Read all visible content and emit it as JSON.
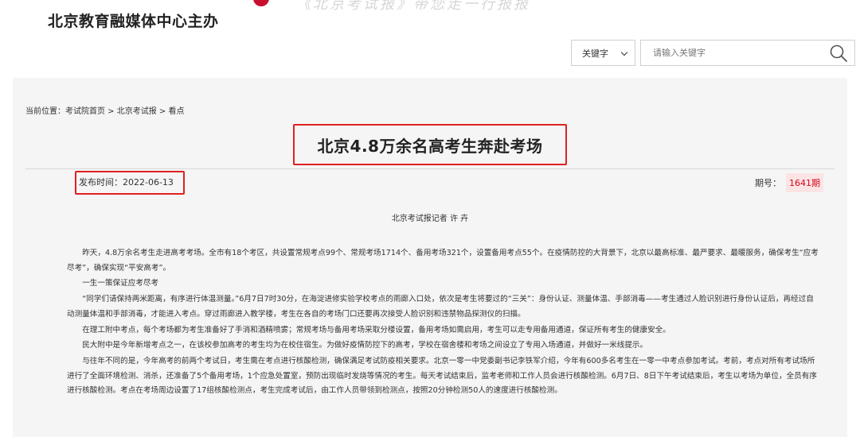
{
  "header": {
    "slogan": "《北京考试报》带您走一行报报",
    "org_title": "北京教育融媒体中心主办",
    "search": {
      "select_value": "关键字",
      "placeholder": "请输入关键字",
      "button_icon": "search-icon"
    }
  },
  "article": {
    "breadcrumb": {
      "prefix": "当前位置：",
      "items": [
        "考试院首页",
        "北京考试报",
        "看点"
      ],
      "separator": " > "
    },
    "title": "北京4.8万余名高考生奔赴考场",
    "publish_label": "发布时间：",
    "publish_date": "2022-06-13",
    "issue_label": "期号：",
    "issue_value": "1641期",
    "byline": "北京考试报记者  许  卉",
    "paragraphs": [
      "昨天，4.8万余名考生走进高考考场。全市有18个考区，共设置常规考点99个、常规考场1714个、备用考场321个，设置备用考点55个。在疫情防控的大背景下，北京以最高标准、最严要求、最暖服务，确保考生“应考尽考”，确保实现“平安高考”。",
      "一生一策保证应考尽考",
      "“同学们请保持两米距离，有序进行体温测量。”6月7日7时30分，在海淀进修实验学校考点的雨廊入口处，依次是考生将要过的“三关”：身份认证、测量体温、手部消毒——考生通过人脸识别进行身份认证后，再经过自动测量体温和手部消毒，才能进入考点。穿过雨廊进入教学楼，考生在各自的考场门口还要再次接受人脸识别和违禁物品探测仪的扫描。",
      "在理工附中考点，每个考场都为考生准备好了手消和酒精喷雾；常规考场与备用考场采取分楼设置，备用考场如需启用，考生可以走专用备用通道，保证所有考生的健康安全。",
      "民大附中是今年新增考点之一，在该校参加高考的考生均为在校住宿生。为做好疫情防控下的高考，学校在宿舍楼和考场之间设立了专用入场通道，并做好一米线提示。",
      "与往年不同的是，今年高考的前两个考试日，考生需在考点进行核酸检测，确保满足考试防疫相关要求。北京一零一中党委副书记李铁军介绍，今年有600多名考生在一零一中考点参加考试。考前，考点对所有考试场所进行了全面环境检测、消杀，还准备了5个备用考场，1个应急处置室，预防出现临时发烧等情况的考生。每天考试结束后，监考老师和工作人员会进行核酸检测。6月7日、8日下午考试结束后，考生以考场为单位，全员有序进行核酸检测。考点在考场周边设置了17组核酸检测点，考生完成考试后，由工作人员带领到检测点，按照20分钟检测50人的速度进行核酸检测。"
    ]
  },
  "colors": {
    "highlight_border": "#e02020",
    "issue_badge_bg": "#fce4e4",
    "issue_badge_text": "#d0021b",
    "panel_bg": "#f5f5f5",
    "logo_red": "#c8102e"
  }
}
